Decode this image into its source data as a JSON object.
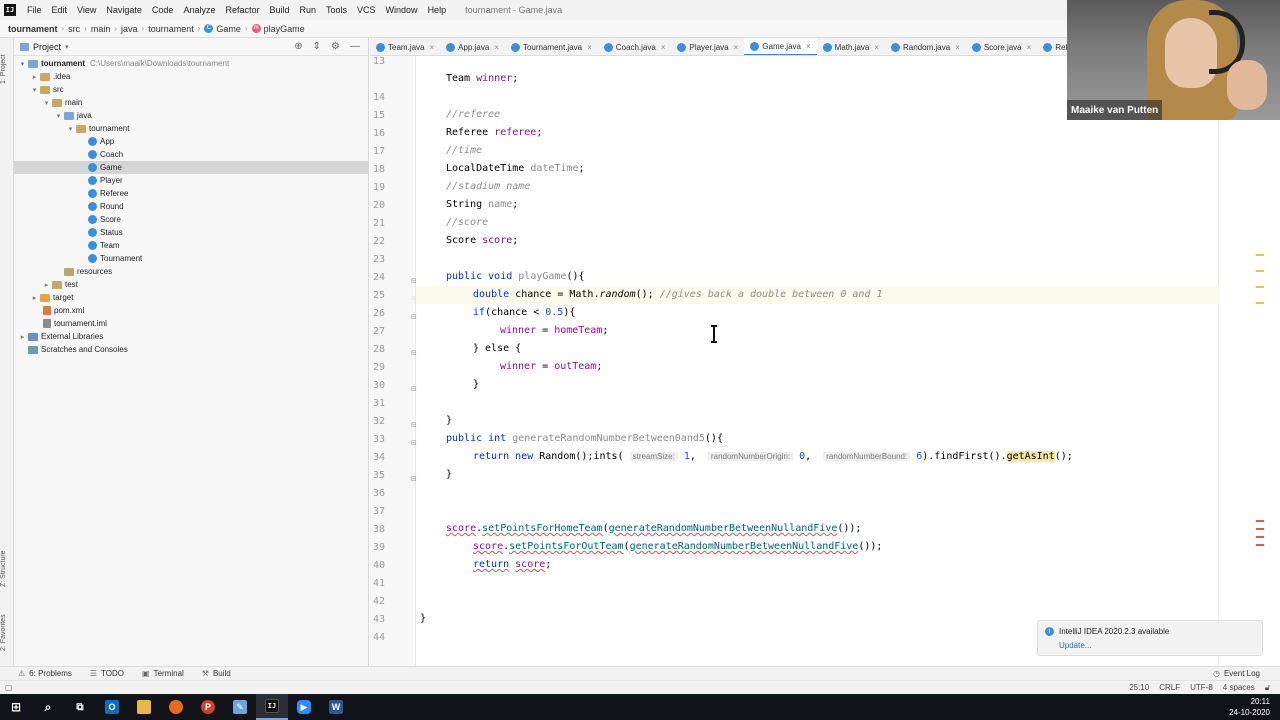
{
  "menubar": {
    "items": [
      "File",
      "Edit",
      "View",
      "Navigate",
      "Code",
      "Analyze",
      "Refactor",
      "Build",
      "Run",
      "Tools",
      "VCS",
      "Window",
      "Help"
    ],
    "window_title": "tournament - Game.java"
  },
  "navbar": {
    "crumbs": [
      "tournament",
      "src",
      "main",
      "java",
      "tournament",
      "Game",
      "playGame"
    ]
  },
  "leftstrip": {
    "project_tab": "1: Project",
    "structure_tab": "Z: Structure",
    "favorites_tab": "2: Favorites"
  },
  "project_panel": {
    "title": "Project",
    "tree": [
      {
        "label": "tournament",
        "path": "C:\\Users\\maaik\\Downloads\\tournament",
        "bold": true
      },
      {
        "label": ".idea"
      },
      {
        "label": "src"
      },
      {
        "label": "main"
      },
      {
        "label": "java"
      },
      {
        "label": "tournament"
      },
      {
        "label": "App"
      },
      {
        "label": "Coach"
      },
      {
        "label": "Game"
      },
      {
        "label": "Player"
      },
      {
        "label": "Referee"
      },
      {
        "label": "Round"
      },
      {
        "label": "Score"
      },
      {
        "label": "Status"
      },
      {
        "label": "Team"
      },
      {
        "label": "Tournament"
      },
      {
        "label": "resources"
      },
      {
        "label": "test"
      },
      {
        "label": "target"
      },
      {
        "label": "pom.xml"
      },
      {
        "label": "tournament.iml"
      },
      {
        "label": "External Libraries"
      },
      {
        "label": "Scratches and Consoles"
      }
    ]
  },
  "tabs": [
    "Team.java",
    "App.java",
    "Tournament.java",
    "Coach.java",
    "Player.java",
    "Game.java",
    "Math.java",
    "Random.java",
    "Score.java",
    "Referee"
  ],
  "editor": {
    "line_numbers": [
      "13",
      "14",
      "15",
      "16",
      "17",
      "18",
      "19",
      "20",
      "21",
      "22",
      "23",
      "24",
      "25",
      "26",
      "27",
      "28",
      "29",
      "30",
      "31",
      "32",
      "33",
      "34",
      "35",
      "36",
      "37",
      "38",
      "39",
      "40",
      "41",
      "42",
      "43",
      "44"
    ],
    "tokens": {
      "team": "Team",
      "winner": "winner",
      "semi": ";",
      "c_referee": "//referee",
      "referee_type": "Referee",
      "referee_field": "referee",
      "c_time": "//time",
      "ldt_type": "LocalDateTime",
      "ldt_field": "dateTime",
      "c_stadium": "//stadium name",
      "string_type": "String",
      "name_field": "name",
      "c_score": "//score",
      "score_type": "Score",
      "score_field": "score",
      "public": "public",
      "void": "void",
      "playGame": "playGame",
      "parens_open": "(){",
      "double_d": "d",
      "double_rest": "ouble",
      "chance": "chance",
      "eq": " = ",
      "math": "Math",
      "dot": ".",
      "random": "random",
      "call_end": "();",
      "c_gives": "//gives back a double between 0 and 1",
      "if": "if",
      "if_open": "(chance < ",
      "num_05": "0.5",
      "if_close": "){",
      "assign": " = ",
      "homeTeam": "homeTeam",
      "else_open": "} else {",
      "outTeam": "outTeam",
      "brace_close": "}",
      "int": "int",
      "gen_fn": "generateRandomNumberBetween0and5",
      "return": "return",
      "new": "new",
      "random_cls": "Random",
      "ints": "ints",
      "hint_stream": "streamSize:",
      "num_1": "1",
      "comma": ", ",
      "hint_origin": "randomNumberOrigin:",
      "num_0": "0",
      "hint_bound": "randomNumberBound:",
      "num_6": "6",
      "findFirst": "findFirst",
      "getAsInt": "getAsInt",
      "paren_open": "(",
      "paren_close_dot": ").",
      "setHome": "setPointsForHomeTeam",
      "setOut": "setPointsForOutTeam",
      "gen_null": "generateRandomNumberBetweenNullandFive",
      "dbl_close": "());",
      "empty_call": "()"
    }
  },
  "notification": {
    "title": "IntelliJ IDEA 2020.2.3 available",
    "link": "Update..."
  },
  "bottomtools": [
    "6: Problems",
    "TODO",
    "Terminal",
    "Build"
  ],
  "event_log": "Event Log",
  "statusbar": {
    "position": "25:10",
    "line_sep": "CRLF",
    "encoding": "UTF-8",
    "indent": "4 spaces"
  },
  "webcam": {
    "name": "Maaike van Putten"
  },
  "taskbar": {
    "time": "20:11",
    "date": "24-10-2020"
  },
  "colors": {
    "keyword": "#0033b3",
    "comment": "#8c8c8c",
    "field": "#871094",
    "method": "#00627a",
    "number": "#1750eb",
    "active_tab": "#4083c9"
  }
}
